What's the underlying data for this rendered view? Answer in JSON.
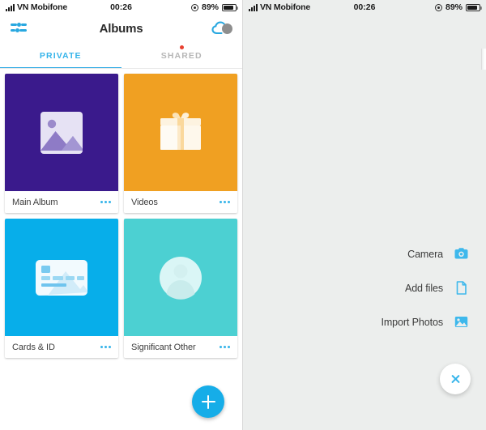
{
  "status_bar": {
    "carrier": "VN Mobifone",
    "time": "00:26",
    "battery_percent": "89%",
    "signal_icon": "signal-bars-icon",
    "location_icon": "location-services-icon",
    "battery_icon": "battery-icon"
  },
  "left_screen": {
    "nav": {
      "title": "Albums",
      "filter_icon": "filter-sliders-icon",
      "cloud_icon": "cloud-sync-icon"
    },
    "tabs": [
      {
        "label": "PRIVATE",
        "active": true,
        "badge": false
      },
      {
        "label": "SHARED",
        "active": false,
        "badge": true
      }
    ],
    "albums": [
      {
        "label": "Main Album",
        "color": "#3A1A8C",
        "art_icon": "photo-image-icon",
        "menu_icon": "more-options-icon"
      },
      {
        "label": "Videos",
        "color": "#F0A022",
        "art_icon": "gift-box-icon",
        "menu_icon": "more-options-icon"
      },
      {
        "label": "Cards & ID",
        "color": "#07AEEA",
        "art_icon": "id-card-icon",
        "menu_icon": "more-options-icon"
      },
      {
        "label": "Significant Other",
        "color": "#4CD0D2",
        "art_icon": "person-avatar-icon",
        "menu_icon": "more-options-icon"
      }
    ],
    "fab": {
      "icon": "plus-icon",
      "color": "#16ADE8"
    }
  },
  "right_screen": {
    "menu_items": [
      {
        "label": "Camera",
        "icon": "camera-icon"
      },
      {
        "label": "Add files",
        "icon": "file-document-icon"
      },
      {
        "label": "Import Photos",
        "icon": "image-picture-icon"
      }
    ],
    "fab": {
      "icon": "close-x-icon",
      "color": "#FFFFFF",
      "glyph_color": "#35B4EA"
    }
  },
  "colors": {
    "accent_blue": "#35B4EA",
    "badge_red": "#E8402F",
    "background": "#ECEEED"
  }
}
